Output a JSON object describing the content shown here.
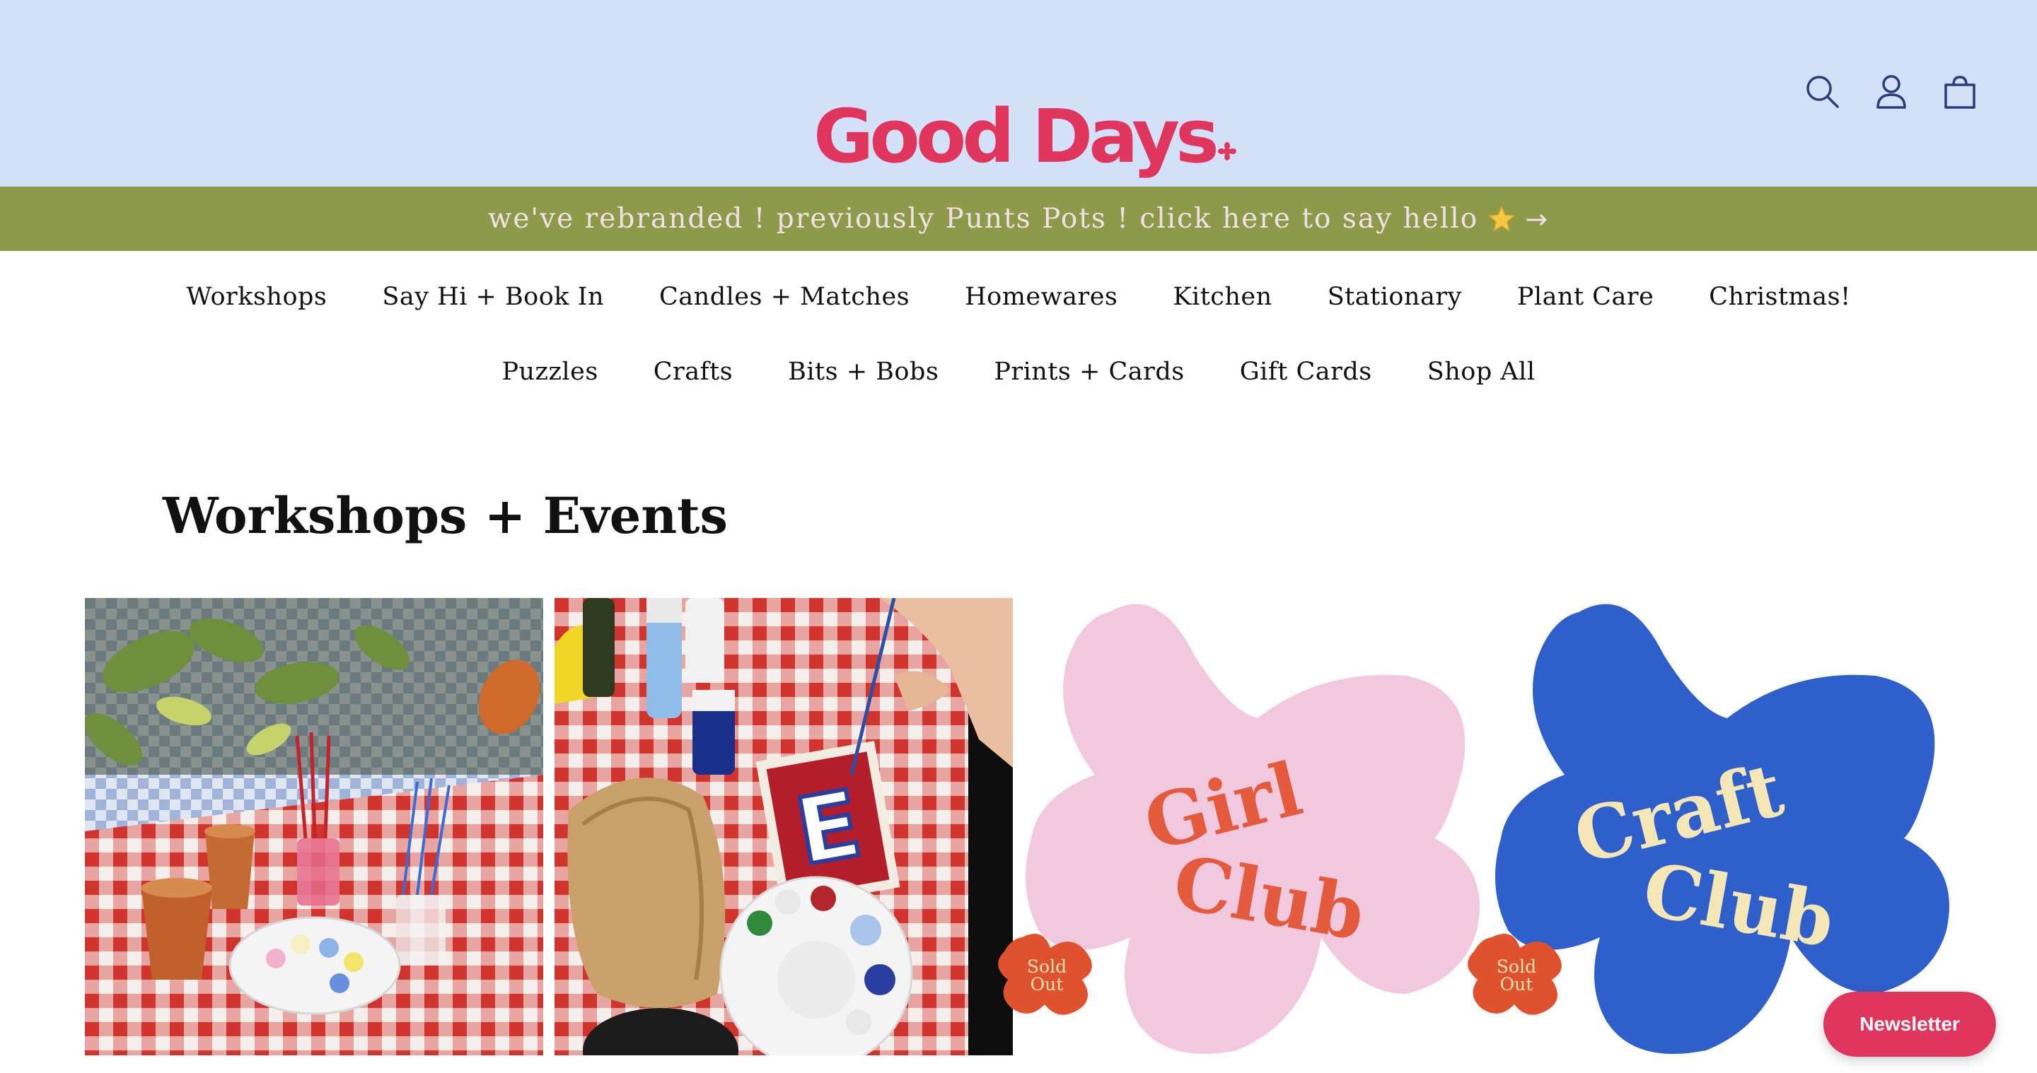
{
  "header": {
    "logo": "Good Days",
    "icons": [
      "search-icon",
      "account-icon",
      "cart-icon"
    ],
    "background": "#d2e0f8",
    "logo_color": "#e0365e"
  },
  "announcement": {
    "text": "we've rebranded ! previously Punts Pots ! click here to say hello",
    "icon": "star-icon",
    "arrow": "→",
    "background": "#8d9a4a"
  },
  "nav": {
    "row1": [
      "Workshops",
      "Say Hi + Book In",
      "Candles + Matches",
      "Homewares",
      "Kitchen",
      "Stationary",
      "Plant Care",
      "Christmas!"
    ],
    "row2": [
      "Puzzles",
      "Crafts",
      "Bits + Bobs",
      "Prints + Cards",
      "Gift Cards",
      "Shop All"
    ]
  },
  "section": {
    "title": "Workshops + Events"
  },
  "cards": [
    {
      "image": "painting-pots-workshop-photo"
    },
    {
      "image": "painting-tile-workshop-photo"
    },
    {
      "image": "girl-club-flower",
      "line1": "Girl",
      "line2": "Club",
      "badge1": "Sold",
      "badge2": "Out",
      "flower_color": "#f2c8df",
      "text_color": "#e35a3c"
    },
    {
      "image": "craft-club-flower",
      "line1": "Craft",
      "line2": "Club",
      "badge1": "Sold",
      "badge2": "Out",
      "flower_color": "#2f5fcb",
      "text_color": "#f5e7b5"
    }
  ],
  "newsletter": {
    "label": "Newsletter"
  }
}
